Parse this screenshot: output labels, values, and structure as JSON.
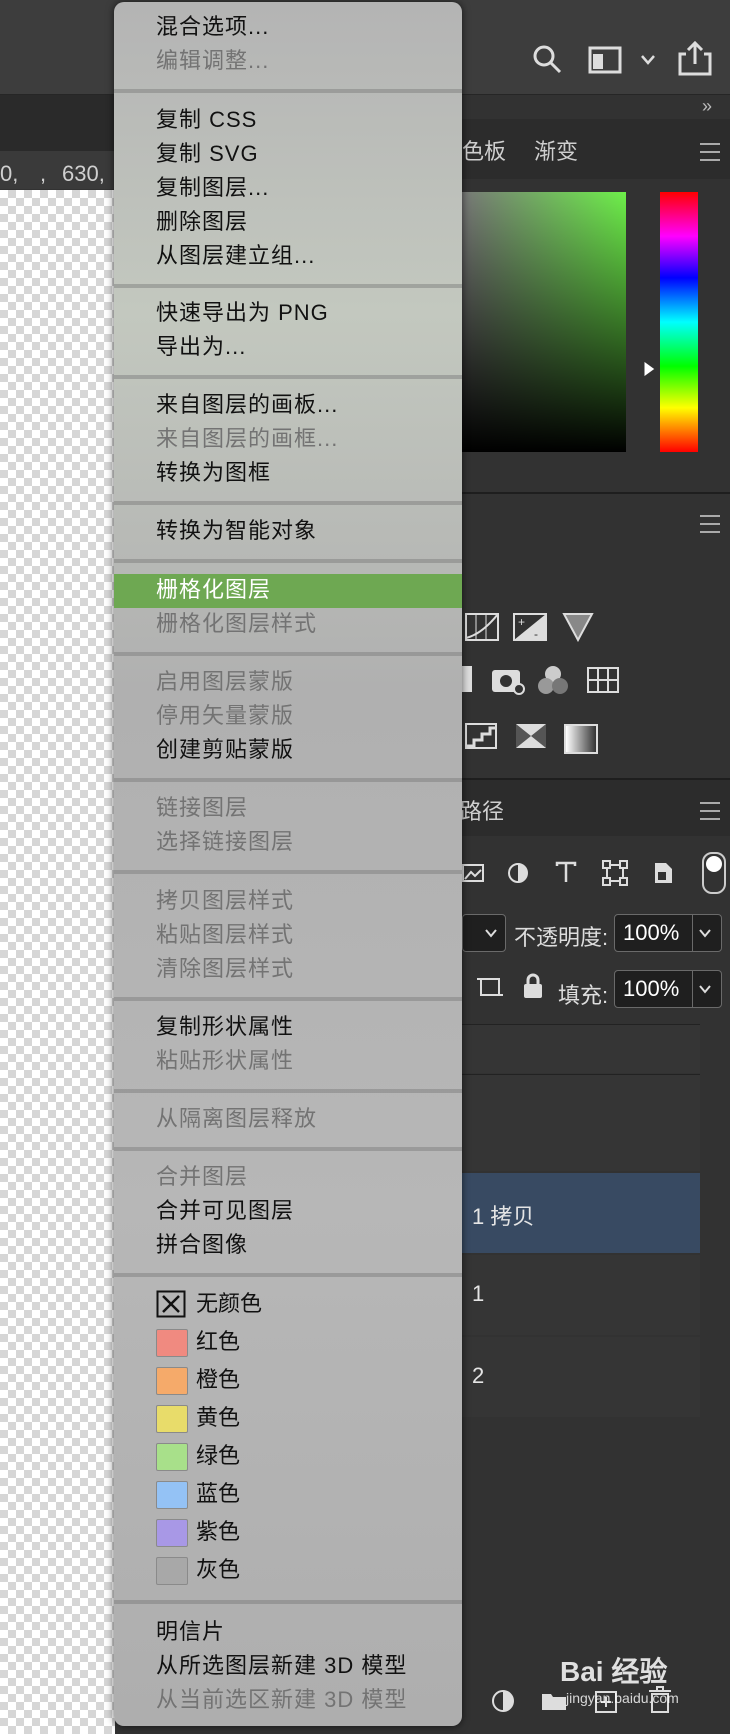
{
  "ruler": {
    "tick_left": "0,",
    "tick_mid": ",",
    "tick_630": "630,"
  },
  "right_panel": {
    "tab_swatches": "色板",
    "tab_gradient": "渐变",
    "tab_paths": "路径",
    "opacity_label": "不透明度:",
    "opacity_value": "100%",
    "fill_label": "填充:",
    "fill_value": "100%",
    "layers": [
      {
        "name": "1 拷贝",
        "selected": true
      },
      {
        "name": "1",
        "selected": false
      },
      {
        "name": "2",
        "selected": false
      }
    ]
  },
  "menu": {
    "groups": [
      [
        {
          "label": "混合选项...",
          "enabled": true
        },
        {
          "label": "编辑调整...",
          "enabled": false
        }
      ],
      [
        {
          "label": "复制 CSS",
          "enabled": true
        },
        {
          "label": "复制 SVG",
          "enabled": true
        },
        {
          "label": "复制图层...",
          "enabled": true
        },
        {
          "label": "删除图层",
          "enabled": true
        },
        {
          "label": "从图层建立组...",
          "enabled": true
        }
      ],
      [
        {
          "label": "快速导出为 PNG",
          "enabled": true
        },
        {
          "label": "导出为...",
          "enabled": true
        }
      ],
      [
        {
          "label": "来自图层的画板...",
          "enabled": true
        },
        {
          "label": "来自图层的画框...",
          "enabled": false
        },
        {
          "label": "转换为图框",
          "enabled": true
        }
      ],
      [
        {
          "label": "转换为智能对象",
          "enabled": true
        }
      ],
      [
        {
          "label": "栅格化图层",
          "enabled": true,
          "highlighted": true
        },
        {
          "label": "栅格化图层样式",
          "enabled": false
        }
      ],
      [
        {
          "label": "启用图层蒙版",
          "enabled": false
        },
        {
          "label": "停用矢量蒙版",
          "enabled": false
        },
        {
          "label": "创建剪贴蒙版",
          "enabled": true
        }
      ],
      [
        {
          "label": "链接图层",
          "enabled": false
        },
        {
          "label": "选择链接图层",
          "enabled": false
        }
      ],
      [
        {
          "label": "拷贝图层样式",
          "enabled": false
        },
        {
          "label": "粘贴图层样式",
          "enabled": false
        },
        {
          "label": "清除图层样式",
          "enabled": false
        }
      ],
      [
        {
          "label": "复制形状属性",
          "enabled": true
        },
        {
          "label": "粘贴形状属性",
          "enabled": false
        }
      ],
      [
        {
          "label": "从隔离图层释放",
          "enabled": false
        }
      ],
      [
        {
          "label": "合并图层",
          "enabled": false
        },
        {
          "label": "合并可见图层",
          "enabled": true
        },
        {
          "label": "拼合图像",
          "enabled": true
        }
      ]
    ],
    "colors": [
      {
        "label": "无颜色",
        "color": "none"
      },
      {
        "label": "红色",
        "color": "#f08a80"
      },
      {
        "label": "橙色",
        "color": "#f5aa6a"
      },
      {
        "label": "黄色",
        "color": "#e8dc6a"
      },
      {
        "label": "绿色",
        "color": "#a8e08a"
      },
      {
        "label": "蓝色",
        "color": "#94c2f5"
      },
      {
        "label": "紫色",
        "color": "#a898e6"
      },
      {
        "label": "灰色",
        "color": "#a8a8a8"
      }
    ],
    "footer": [
      {
        "label": "明信片",
        "enabled": true
      },
      {
        "label": "从所选图层新建 3D 模型",
        "enabled": true
      },
      {
        "label": "从当前选区新建 3D 模型",
        "enabled": false
      }
    ]
  },
  "watermark": "Bai 经验",
  "watermark_url": "jingyan.baidu.com"
}
